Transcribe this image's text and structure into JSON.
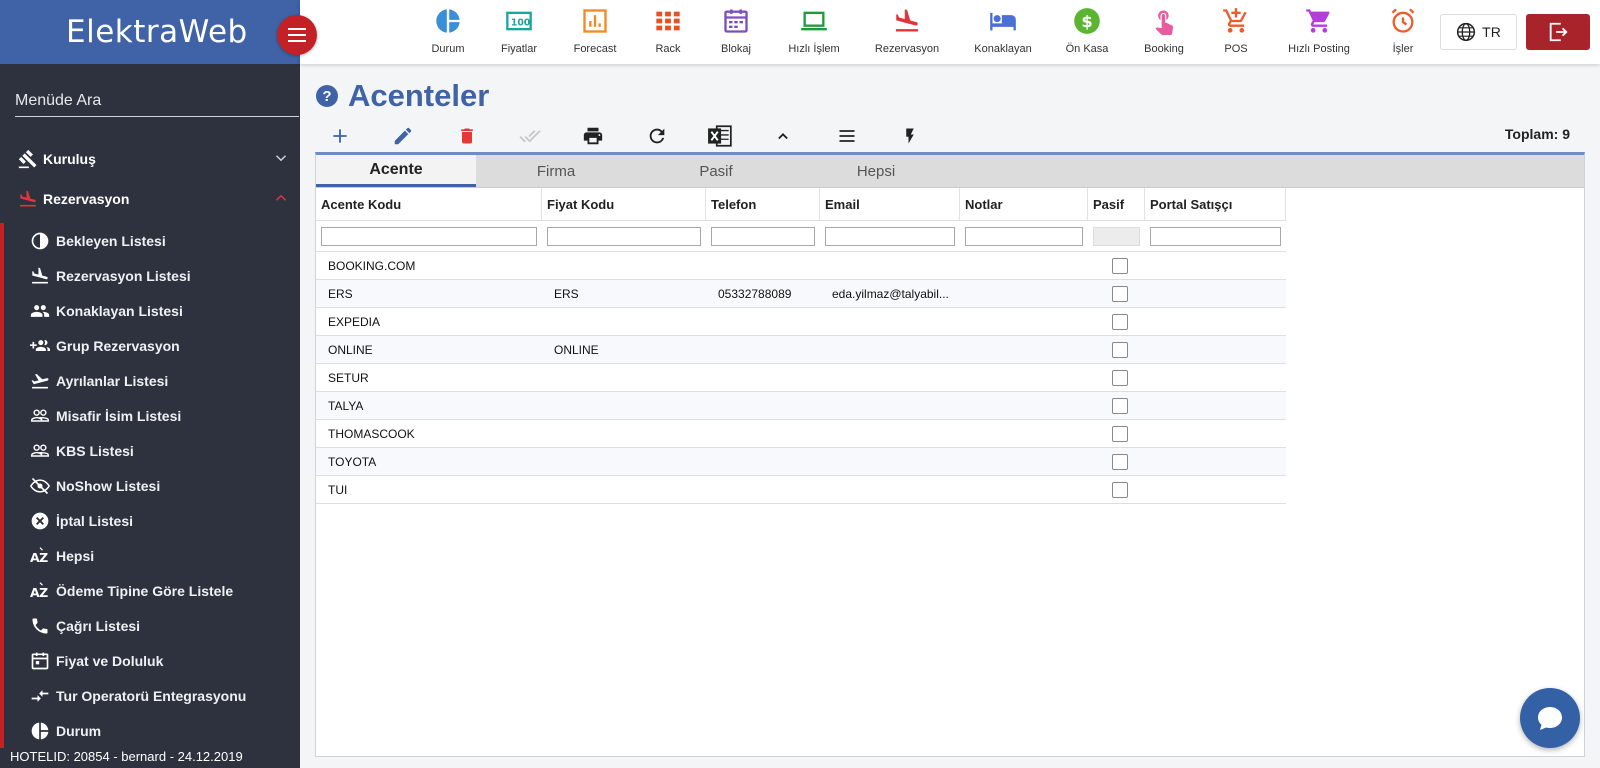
{
  "brand": "ElektraWeb",
  "sidebar": {
    "search_placeholder": "Menüde Ara",
    "sections": [
      {
        "label": "Kuruluş",
        "expanded": false
      },
      {
        "label": "Rezervasyon",
        "expanded": true
      }
    ],
    "items": [
      {
        "label": "Bekleyen Listesi",
        "icon": "pie-icon"
      },
      {
        "label": "Rezervasyon Listesi",
        "icon": "flight-land-icon"
      },
      {
        "label": "Konaklayan Listesi",
        "icon": "people-icon"
      },
      {
        "label": "Grup Rezervasyon",
        "icon": "group-add-icon"
      },
      {
        "label": "Ayrılanlar Listesi",
        "icon": "flight-takeoff-icon"
      },
      {
        "label": "Misafir İsim Listesi",
        "icon": "people-outline-icon"
      },
      {
        "label": "KBS Listesi",
        "icon": "people-outline-icon"
      },
      {
        "label": "NoShow Listesi",
        "icon": "eye-off-icon"
      },
      {
        "label": "İptal Listesi",
        "icon": "cancel-icon"
      },
      {
        "label": "Hepsi",
        "icon": "sort-az-icon"
      },
      {
        "label": "Ödeme Tipine Göre Listele",
        "icon": "sort-az-icon"
      },
      {
        "label": "Çağrı Listesi",
        "icon": "phone-icon"
      },
      {
        "label": "Fiyat ve Doluluk",
        "icon": "calendar-icon"
      },
      {
        "label": "Tur Operatorü Entegrasyonu",
        "icon": "compare-arrows-icon"
      },
      {
        "label": "Durum",
        "icon": "pie-icon"
      }
    ],
    "footer": "HOTELID: 20854 - bernard - 24.12.2019"
  },
  "topnav": [
    {
      "label": "Durum",
      "icon": "pie-chart-icon",
      "color": "#3b8fd9"
    },
    {
      "label": "Fiyatlar",
      "icon": "price-tag-icon",
      "color": "#1aa79b"
    },
    {
      "label": "Forecast",
      "icon": "bar-chart-icon",
      "color": "#f08a24"
    },
    {
      "label": "Rack",
      "icon": "grid-icon",
      "color": "#e8501f"
    },
    {
      "label": "Blokaj",
      "icon": "calendar-icon",
      "color": "#7a4fc0"
    },
    {
      "label": "Hızlı İşlem",
      "icon": "laptop-icon",
      "color": "#1e9c3c"
    },
    {
      "label": "Rezervasyon",
      "icon": "flight-land-icon",
      "color": "#e0353a"
    },
    {
      "label": "Konaklayan",
      "icon": "bed-icon",
      "color": "#4a6fd6"
    },
    {
      "label": "Ön Kasa",
      "icon": "dollar-icon",
      "color": "#5cb531"
    },
    {
      "label": "Booking",
      "icon": "touch-icon",
      "color": "#ea5a9f"
    },
    {
      "label": "POS",
      "icon": "cart-add-icon",
      "color": "#ef5a2a"
    },
    {
      "label": "Hızlı Posting",
      "icon": "cart-icon",
      "color": "#b43fd8"
    },
    {
      "label": "İşler",
      "icon": "alarm-icon",
      "color": "#ef5a2a"
    }
  ],
  "language": "TR",
  "page": {
    "title": "Acenteler",
    "total": "Toplam: 9"
  },
  "toolbar": [
    "add-icon",
    "edit-icon",
    "delete-icon",
    "check-all-icon",
    "print-icon",
    "refresh-icon",
    "excel-icon",
    "collapse-icon",
    "menu-icon",
    "flash-icon"
  ],
  "tabs": [
    {
      "label": "Acente",
      "active": true
    },
    {
      "label": "Firma",
      "active": false
    },
    {
      "label": "Pasif",
      "active": false
    },
    {
      "label": "Hepsi",
      "active": false
    }
  ],
  "table": {
    "columns": [
      "Acente Kodu",
      "Fiyat Kodu",
      "Telefon",
      "Email",
      "Notlar",
      "Pasif",
      "Portal Satışçı"
    ],
    "rows": [
      {
        "acente_kodu": "BOOKING.COM",
        "fiyat_kodu": "",
        "telefon": "",
        "email": "",
        "notlar": "",
        "pasif": false,
        "portal": ""
      },
      {
        "acente_kodu": "ERS",
        "fiyat_kodu": "ERS",
        "telefon": "05332788089",
        "email": "eda.yilmaz@talyabil...",
        "notlar": "",
        "pasif": false,
        "portal": ""
      },
      {
        "acente_kodu": "EXPEDIA",
        "fiyat_kodu": "",
        "telefon": "",
        "email": "",
        "notlar": "",
        "pasif": false,
        "portal": ""
      },
      {
        "acente_kodu": "ONLINE",
        "fiyat_kodu": "ONLINE",
        "telefon": "",
        "email": "",
        "notlar": "",
        "pasif": false,
        "portal": ""
      },
      {
        "acente_kodu": "SETUR",
        "fiyat_kodu": "",
        "telefon": "",
        "email": "",
        "notlar": "",
        "pasif": false,
        "portal": ""
      },
      {
        "acente_kodu": "TALYA",
        "fiyat_kodu": "",
        "telefon": "",
        "email": "",
        "notlar": "",
        "pasif": false,
        "portal": ""
      },
      {
        "acente_kodu": "THOMASCOOK",
        "fiyat_kodu": "",
        "telefon": "",
        "email": "",
        "notlar": "",
        "pasif": false,
        "portal": ""
      },
      {
        "acente_kodu": "TOYOTA",
        "fiyat_kodu": "",
        "telefon": "",
        "email": "",
        "notlar": "",
        "pasif": false,
        "portal": ""
      },
      {
        "acente_kodu": "TUI",
        "fiyat_kodu": "",
        "telefon": "",
        "email": "",
        "notlar": "",
        "pasif": false,
        "portal": ""
      }
    ]
  },
  "colors": {
    "brand_blue": "#3f63a6",
    "sidebar_bg": "#2d323e",
    "accent_red": "#c42127"
  }
}
